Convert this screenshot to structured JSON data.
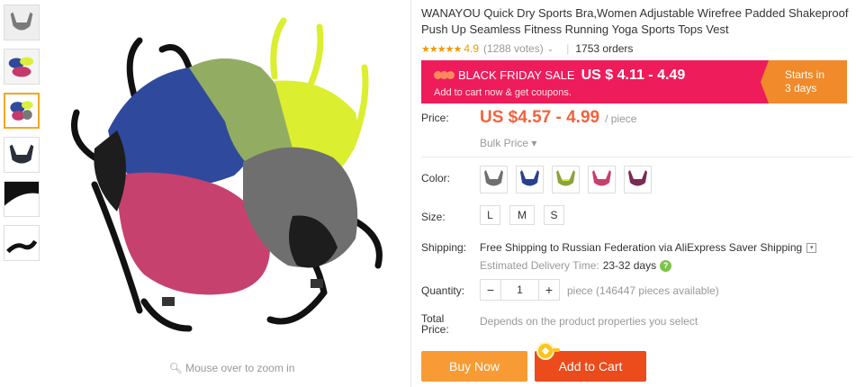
{
  "product": {
    "title": "WANAYOU Quick Dry Sports Bra,Women Adjustable Wirefree Padded Shakeproof Push Up Seamless Fitness Running Yoga Sports Tops Vest",
    "stars": "★★★★★",
    "rating": "4.9",
    "votes": "(1288 votes)",
    "orders": "1753 orders"
  },
  "sale": {
    "label": "BLACK FRIDAY SALE",
    "price": "US $ 4.11 - 4.49",
    "sub": "Add to cart now & get coupons.",
    "starts_line1": "Starts in",
    "starts_line2": "3 days",
    "banner_color": "#ee1c5b",
    "badge_color": "#f08a2a"
  },
  "price": {
    "label": "Price:",
    "value": "US $4.57 - 4.99",
    "unit": "/ piece",
    "bulk": "Bulk Price"
  },
  "color": {
    "label": "Color:",
    "options": [
      "gray",
      "blue",
      "yellow",
      "pink",
      "purple"
    ]
  },
  "size": {
    "label": "Size:",
    "options": [
      "L",
      "M",
      "S"
    ]
  },
  "shipping": {
    "label": "Shipping:",
    "main": "Free Shipping to Russian Federation via AliExpress Saver Shipping",
    "eta_label": "Estimated Delivery Time:",
    "eta_value": "23-32 days",
    "help": "?"
  },
  "quantity": {
    "label": "Quantity:",
    "value": "1",
    "minus": "−",
    "plus": "+",
    "available": "piece (146447 pieces available)"
  },
  "total": {
    "label_line1": "Total",
    "label_line2": "Price:",
    "value": "Depends on the product properties you select"
  },
  "actions": {
    "buy": "Buy Now",
    "cart": "Add to Cart"
  },
  "gallery": {
    "zoom_hint": "Mouse over to zoom in"
  },
  "colors": {
    "price": "#f5613b",
    "buy_button": "#f89b34",
    "cart_button": "#ec4b1c",
    "star": "#f39801"
  }
}
